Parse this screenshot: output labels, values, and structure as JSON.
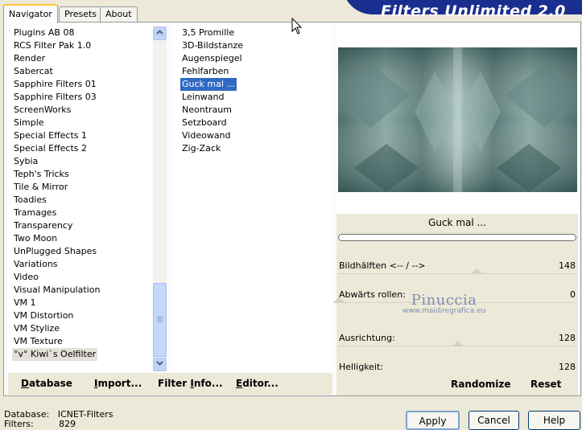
{
  "tabs": [
    "Navigator",
    "Presets",
    "About"
  ],
  "brand": "Filters Unlimited 2.0",
  "categories": [
    "Plugins AB 08",
    "RCS Filter Pak 1.0",
    "Render",
    "Sabercat",
    "Sapphire Filters 01",
    "Sapphire Filters 03",
    "ScreenWorks",
    "Simple",
    "Special Effects 1",
    "Special Effects 2",
    "Sybia",
    "Teph's Tricks",
    "Tile & Mirror",
    "Toadies",
    "Tramages",
    "Transparency",
    "Two Moon",
    "UnPlugged Shapes",
    "Variations",
    "Video",
    "Visual Manipulation",
    "VM 1",
    "VM Distortion",
    "VM Stylize",
    "VM Texture",
    "°v° Kiwi`s Oelfilter"
  ],
  "selected_category_index": 25,
  "filters": [
    "3,5 Promille",
    "3D-Bildstanze",
    "Augenspiegel",
    "Fehlfarben",
    "Guck mal ...",
    "Leinwand",
    "Neontraum",
    "Setzboard",
    "Videowand",
    "Zig-Zack"
  ],
  "selected_filter_index": 4,
  "bottom_buttons": {
    "database": {
      "u": "D",
      "rest": "atabase"
    },
    "import": {
      "pre": "",
      "u": "I",
      "rest": "mport..."
    },
    "filter_info": {
      "pre": "Filter ",
      "u": "I",
      "rest": "nfo..."
    },
    "editor": {
      "u": "E",
      "rest": "ditor..."
    }
  },
  "current_filter_name": "Guck mal ...",
  "params": [
    {
      "label": "Bildhälften <-- / -->",
      "value": "148",
      "level": 148,
      "max": 255
    },
    {
      "label": "Abwärts rollen:",
      "value": "0",
      "level": 0,
      "max": 255
    },
    {
      "label": "Ausrichtung:",
      "value": "128",
      "level": 128,
      "max": 255
    },
    {
      "label": "Helligkeit:",
      "value": "128",
      "level": 128,
      "max": 255
    }
  ],
  "randomize_label": "Randomize",
  "reset_label": "Reset",
  "watermark": {
    "line1": "Pinuccia",
    "line2": "www.maidiregrafica.eu"
  },
  "status": {
    "db_label": "Database:",
    "db_value": "ICNET-Filters",
    "filters_label": "Filters:",
    "filters_value": "829"
  },
  "dialog_buttons": {
    "apply": "Apply",
    "cancel": "Cancel",
    "help": "Help"
  },
  "colors": {
    "selection": "#316AC5",
    "preview_tint": "#4F7A77",
    "brand": "#1A2E8F"
  }
}
